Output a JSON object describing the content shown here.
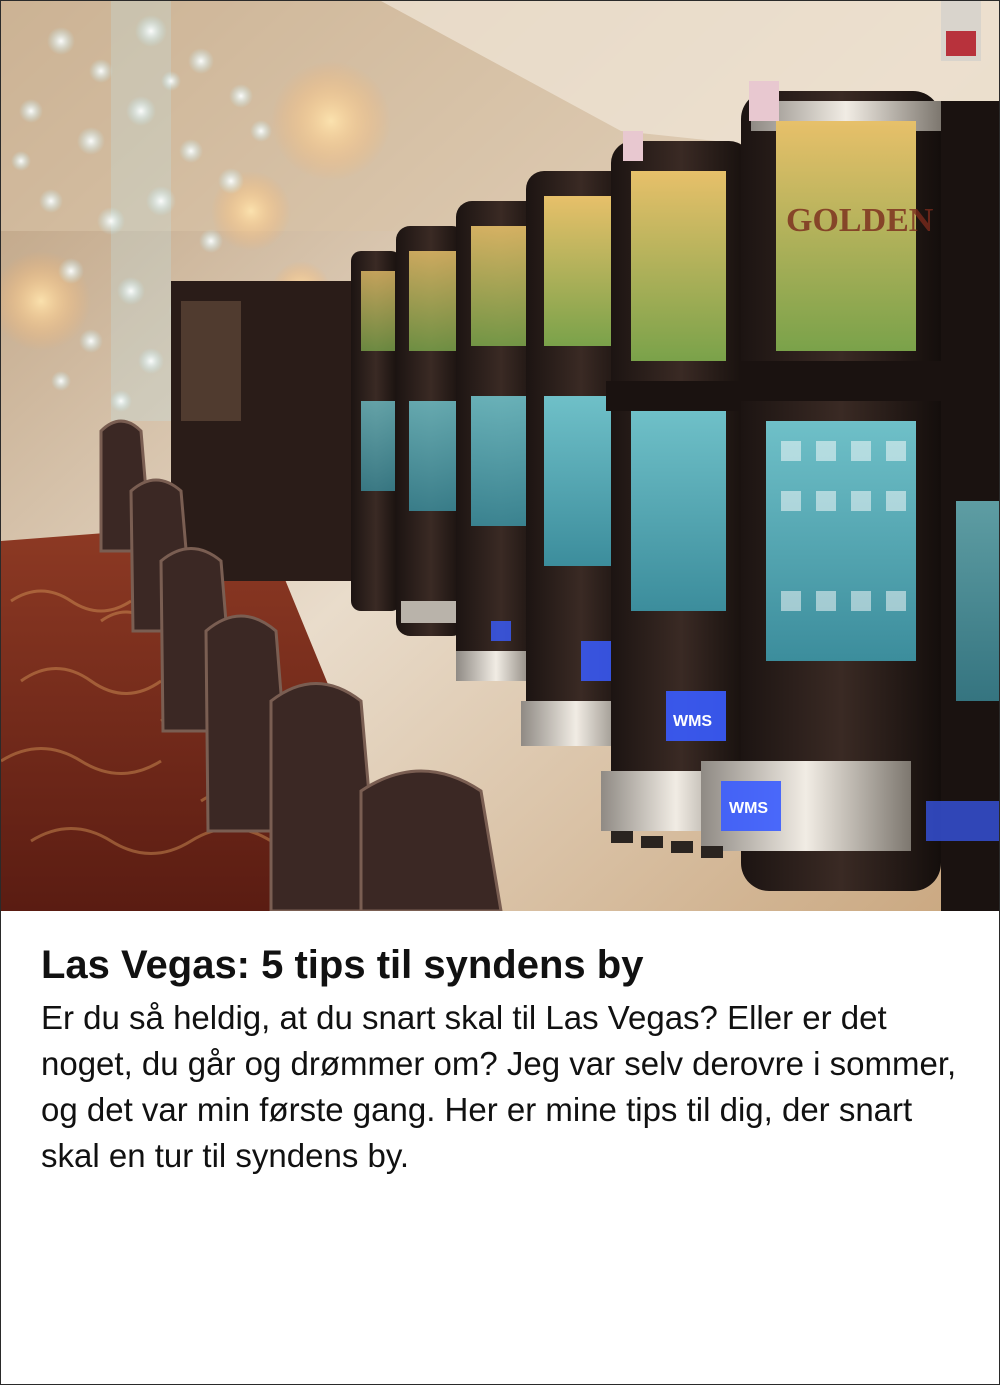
{
  "article": {
    "headline": "Las Vegas: 5 tips til syndens by",
    "teaser": "Er du så heldig, at du snart skal til Las Vegas? Eller er det noget, du går og drømmer om? Jeg var selv derovre i sommer, og det var min første gang. Her er mine tips til dig, der snart skal en tur til syndens by."
  },
  "photo": {
    "colors": {
      "carpet": "#7a2a1c",
      "machine_body": "#2a1f1c",
      "screen_teal": "#4fa7b5",
      "screen_gold": "#c99a3a",
      "chrome": "#d9d4cc",
      "ceiling": "#e9dccb",
      "chandelier": "#bfe9f0",
      "button_blue": "#3a5cff"
    }
  }
}
